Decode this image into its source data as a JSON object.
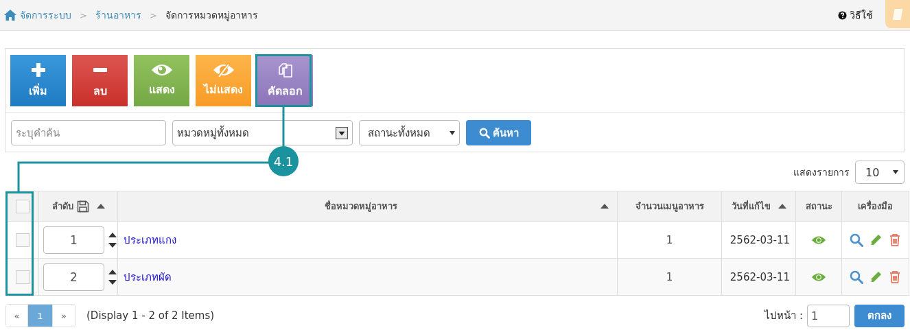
{
  "breadcrumb": [
    {
      "label": "จัดการระบบ",
      "link": true
    },
    {
      "separator": ">",
      "label": "ร้านอาหาร",
      "link": true
    },
    {
      "separator": ">",
      "label": "จัดการหมวดหมู่อาหาร",
      "link": false
    }
  ],
  "help": {
    "label": "วิธีใช้"
  },
  "toolbar": [
    {
      "label": "เพิ่ม",
      "kind": "add"
    },
    {
      "label": "ลบ",
      "kind": "delete"
    },
    {
      "label": "แสดง",
      "kind": "show"
    },
    {
      "label": "ไม่แสดง",
      "kind": "hide"
    },
    {
      "label": "คัดลอก",
      "kind": "copy"
    }
  ],
  "annotation": {
    "label": "4.1"
  },
  "search": {
    "placeholder": "ระบุคำค้น",
    "category": "หมวดหมู่ทั้งหมด",
    "status": "สถานะทั้งหมด",
    "button": "ค้นหา"
  },
  "page_size": {
    "label": "แสดงรายการ",
    "value": "10"
  },
  "table": {
    "all_checked": false,
    "columns": [
      {
        "label": "ลำดับ",
        "kind": "order",
        "sortable": true
      },
      {
        "label": "ชื่อหมวดหมู่อาหาร",
        "kind": "name",
        "sortable": true
      },
      {
        "label": "จำนวนเมนูอาหาร",
        "kind": "count",
        "sortable": false
      },
      {
        "label": "วันที่แก้ไข",
        "kind": "date",
        "sortable": true
      },
      {
        "label": "สถานะ",
        "kind": "status",
        "sortable": false
      },
      {
        "label": "เครื่องมือ",
        "kind": "tools",
        "sortable": false
      }
    ],
    "rows": [
      {
        "checked": false,
        "order": "1",
        "name": "ประเภทแกง",
        "count": "1",
        "date": "2562-03-11",
        "visible": true
      },
      {
        "checked": false,
        "order": "2",
        "name": "ประเภทผัด",
        "count": "1",
        "date": "2562-03-11",
        "visible": true
      }
    ]
  },
  "pagination": {
    "prev": "«",
    "pages": [
      {
        "label": "1",
        "selected": true
      }
    ],
    "next": "»",
    "summary": "(Display 1 - 2 of 2 Items)",
    "goto_label": "ไปหน้า :",
    "goto_value": "1",
    "go_button": "ตกลง"
  }
}
